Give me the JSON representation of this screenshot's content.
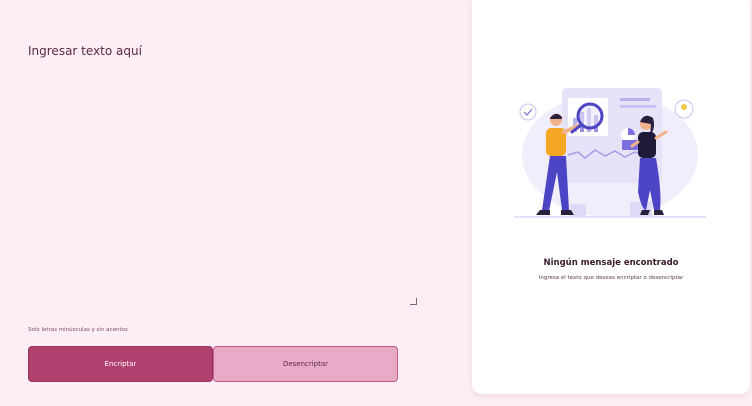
{
  "input": {
    "placeholder": "Ingresar texto aquí",
    "value": "",
    "hint": "Solo letras minúsculas y sin acentos"
  },
  "buttons": {
    "encrypt_label": "Encriptar",
    "decrypt_label": "Desencriptar"
  },
  "output": {
    "empty_title": "Ningún mensaje encontrado",
    "empty_subtitle": "Ingresa el texto que deseas encriptar o desencriptar"
  },
  "colors": {
    "page_background": "#fdeef5",
    "primary_button": "#b0416f",
    "secondary_button": "#e8aac6",
    "card_background": "#ffffff"
  },
  "icons": {
    "illustration": "search-analytics-illustration"
  }
}
